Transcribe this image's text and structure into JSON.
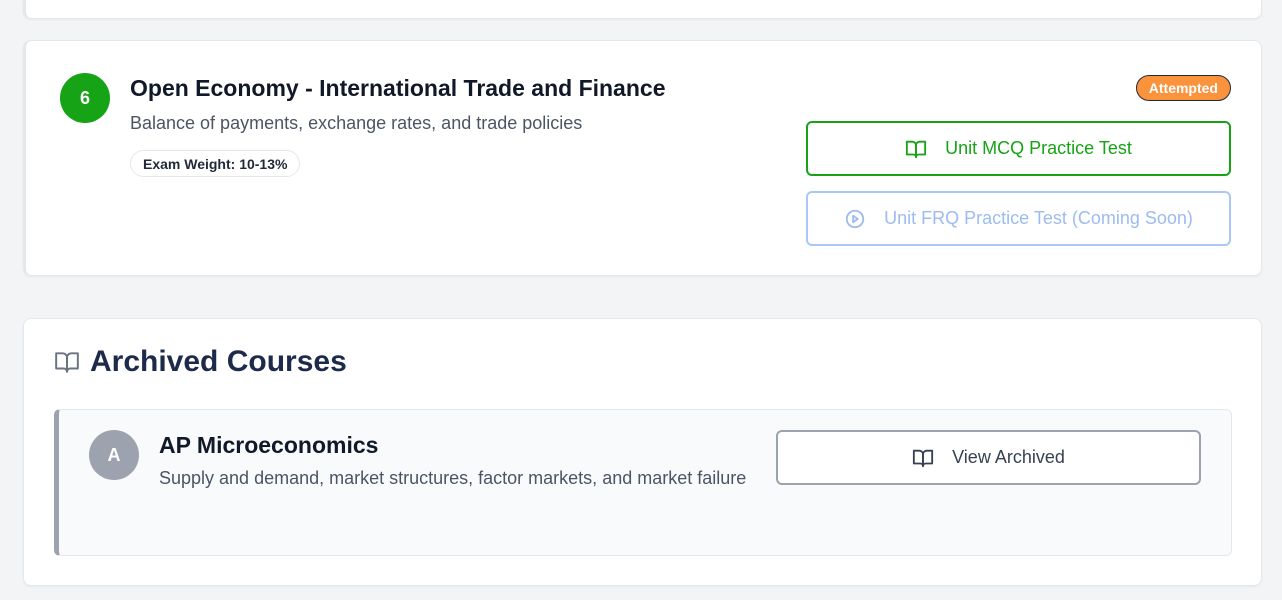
{
  "unit": {
    "number": "6",
    "title": "Open Economy - International Trade and Finance",
    "description": "Balance of payments, exchange rates, and trade policies",
    "exam_weight": "Exam Weight: 10-13%",
    "status": "Attempted",
    "mcq_button": "Unit MCQ Practice Test",
    "frq_button": "Unit FRQ Practice Test (Coming Soon)"
  },
  "archived": {
    "heading": "Archived Courses",
    "courses": [
      {
        "avatar": "A",
        "title": "AP Microeconomics",
        "description": "Supply and demand, market structures, factor markets, and market failure",
        "button": "View Archived"
      }
    ]
  },
  "icons": {
    "mcq": "book-open-icon",
    "frq": "play-circle-icon",
    "archived_heading": "book-open-icon",
    "view_archived": "book-open-icon"
  },
  "colors": {
    "accent_green": "#16a316",
    "status_orange": "#fb923c",
    "disabled_blue": "#9cbcf0",
    "archived_gray": "#9ca3af"
  }
}
